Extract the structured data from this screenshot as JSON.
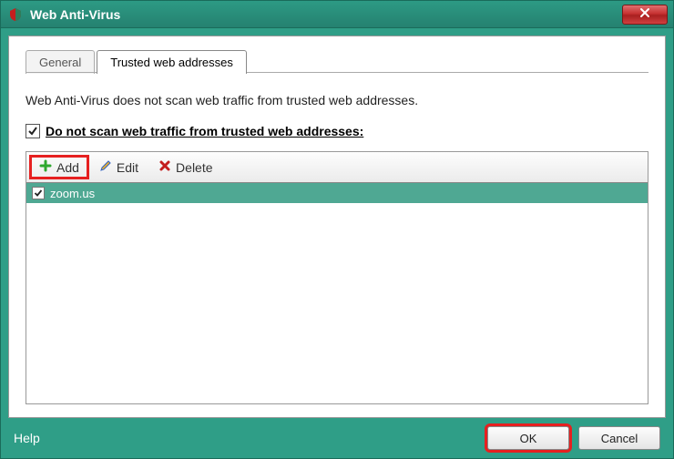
{
  "window": {
    "title": "Web Anti-Virus"
  },
  "tabs": {
    "general": "General",
    "trusted": "Trusted web addresses"
  },
  "body": {
    "description": "Web Anti-Virus does not scan web traffic from trusted web addresses.",
    "checkbox_label": "Do not scan web traffic from trusted web addresses:"
  },
  "toolbar": {
    "add": "Add",
    "edit": "Edit",
    "delete": "Delete"
  },
  "list": {
    "items": [
      {
        "label": "zoom.us",
        "checked": true
      }
    ]
  },
  "footer": {
    "help": "Help",
    "ok": "OK",
    "cancel": "Cancel"
  }
}
